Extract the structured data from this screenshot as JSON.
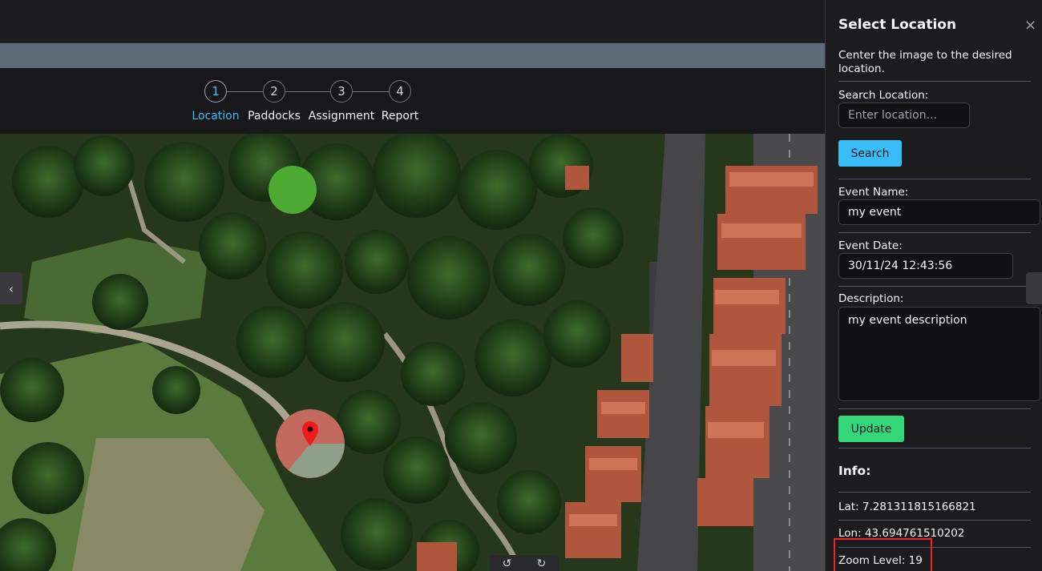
{
  "stepper": {
    "steps": [
      {
        "number": "1",
        "label": "Location"
      },
      {
        "number": "2",
        "label": "Paddocks"
      },
      {
        "number": "3",
        "label": "Assignment"
      },
      {
        "number": "4",
        "label": "Report"
      }
    ],
    "active_step": 1,
    "active_color": "#38bdf8"
  },
  "map": {
    "left_toggle_icon": "chevron-left-icon",
    "marker_icon": "map-pin-icon",
    "marker_color": "#ef1c1c",
    "controls": [
      "rotate-left-icon",
      "rotate-right-icon"
    ]
  },
  "panel": {
    "title": "Select Location",
    "close_icon": "×",
    "description": "Center the image to the desired location.",
    "search": {
      "label": "Search Location:",
      "placeholder": "Enter location...",
      "value": "",
      "button": "Search"
    },
    "event_name": {
      "label": "Event Name:",
      "value": "my event"
    },
    "event_date": {
      "label": "Event Date:",
      "value": "30/11/24 12:43:56"
    },
    "description_field": {
      "label": "Description:",
      "value": "my event description"
    },
    "update_button": "Update",
    "info": {
      "title": "Info:",
      "lat": "Lat: 7.281311815166821",
      "lon": "Lon: 43.694761510202",
      "zoom": "Zoom Level: 19"
    }
  },
  "colors": {
    "search_button": "#38bdf8",
    "update_button": "#34d67a",
    "highlight_box": "#ef2424"
  }
}
